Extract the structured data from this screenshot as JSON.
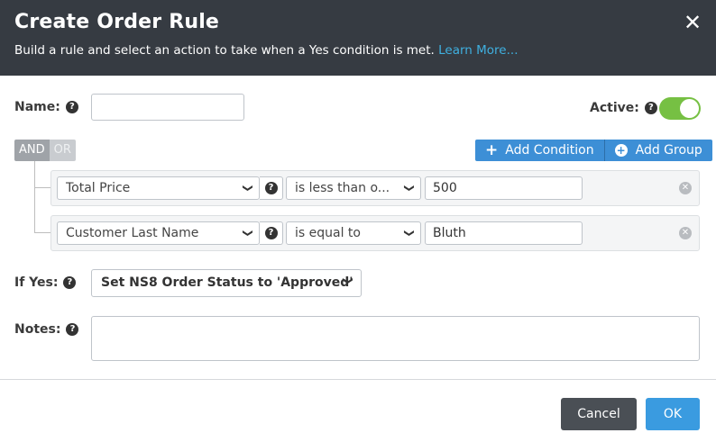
{
  "dialog": {
    "title": "Create Order Rule",
    "subtitle": "Build a rule and select an action to take when a Yes condition is met.",
    "learn_more": "Learn More...",
    "close_glyph": "✕"
  },
  "name": {
    "label": "Name:",
    "value": "",
    "placeholder": ""
  },
  "active": {
    "label": "Active:",
    "on": true
  },
  "logic": {
    "and_label": "AND",
    "or_label": "OR",
    "selected": "AND"
  },
  "actions": {
    "add_condition": "Add Condition",
    "add_group": "Add Group"
  },
  "conditions": [
    {
      "field": "Total Price",
      "operator": "is less than o...",
      "value": "500"
    },
    {
      "field": "Customer Last Name",
      "operator": "is equal to",
      "value": "Bluth"
    }
  ],
  "if_yes": {
    "label": "If Yes:",
    "selected": "Set NS8 Order Status to 'Approved'"
  },
  "notes": {
    "label": "Notes:",
    "value": ""
  },
  "footer": {
    "cancel": "Cancel",
    "ok": "OK"
  },
  "colors": {
    "header_bg": "#363b42",
    "accent": "#3d8fd6",
    "toggle_on": "#76c043",
    "link": "#3fb0e0"
  },
  "icons": {
    "help": "question-circle-icon",
    "close": "close-icon",
    "remove": "remove-circle-icon",
    "chevron": "chevron-down-icon",
    "plus": "plus-icon",
    "plus_circle": "plus-circle-icon"
  }
}
